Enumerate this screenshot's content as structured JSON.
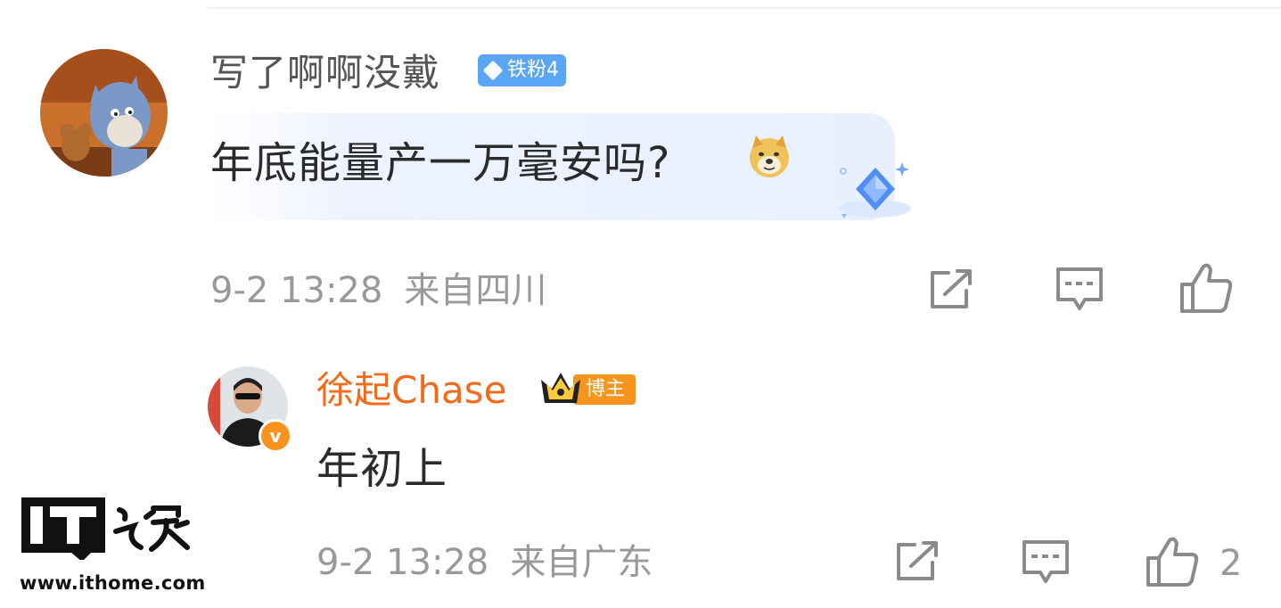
{
  "comment": {
    "user_name": "写了啊啊没戴",
    "fan_badge": "铁粉4",
    "text": "年底能量产一万毫安吗?",
    "emoji_icon": "doge-emoji-icon",
    "timestamp": "9-2 13:28",
    "location": "来自四川",
    "like_count": ""
  },
  "reply": {
    "user_name": "徐起Chase",
    "role_badge": "博主",
    "text": "年初上",
    "timestamp": "9-2 13:28",
    "location": "来自广东",
    "like_count": "2"
  },
  "actions": {
    "share_icon": "share-icon",
    "comment_icon": "comment-icon",
    "like_icon": "thumbs-up-icon"
  },
  "watermark": {
    "logo": "IT之家",
    "url": "www.ithome.com"
  },
  "colors": {
    "blogger_name": "#f26a1b",
    "fan_badge_bg": "#5aa6f5",
    "meta_text": "#999999",
    "bubble_bg": "#eef3ff"
  }
}
